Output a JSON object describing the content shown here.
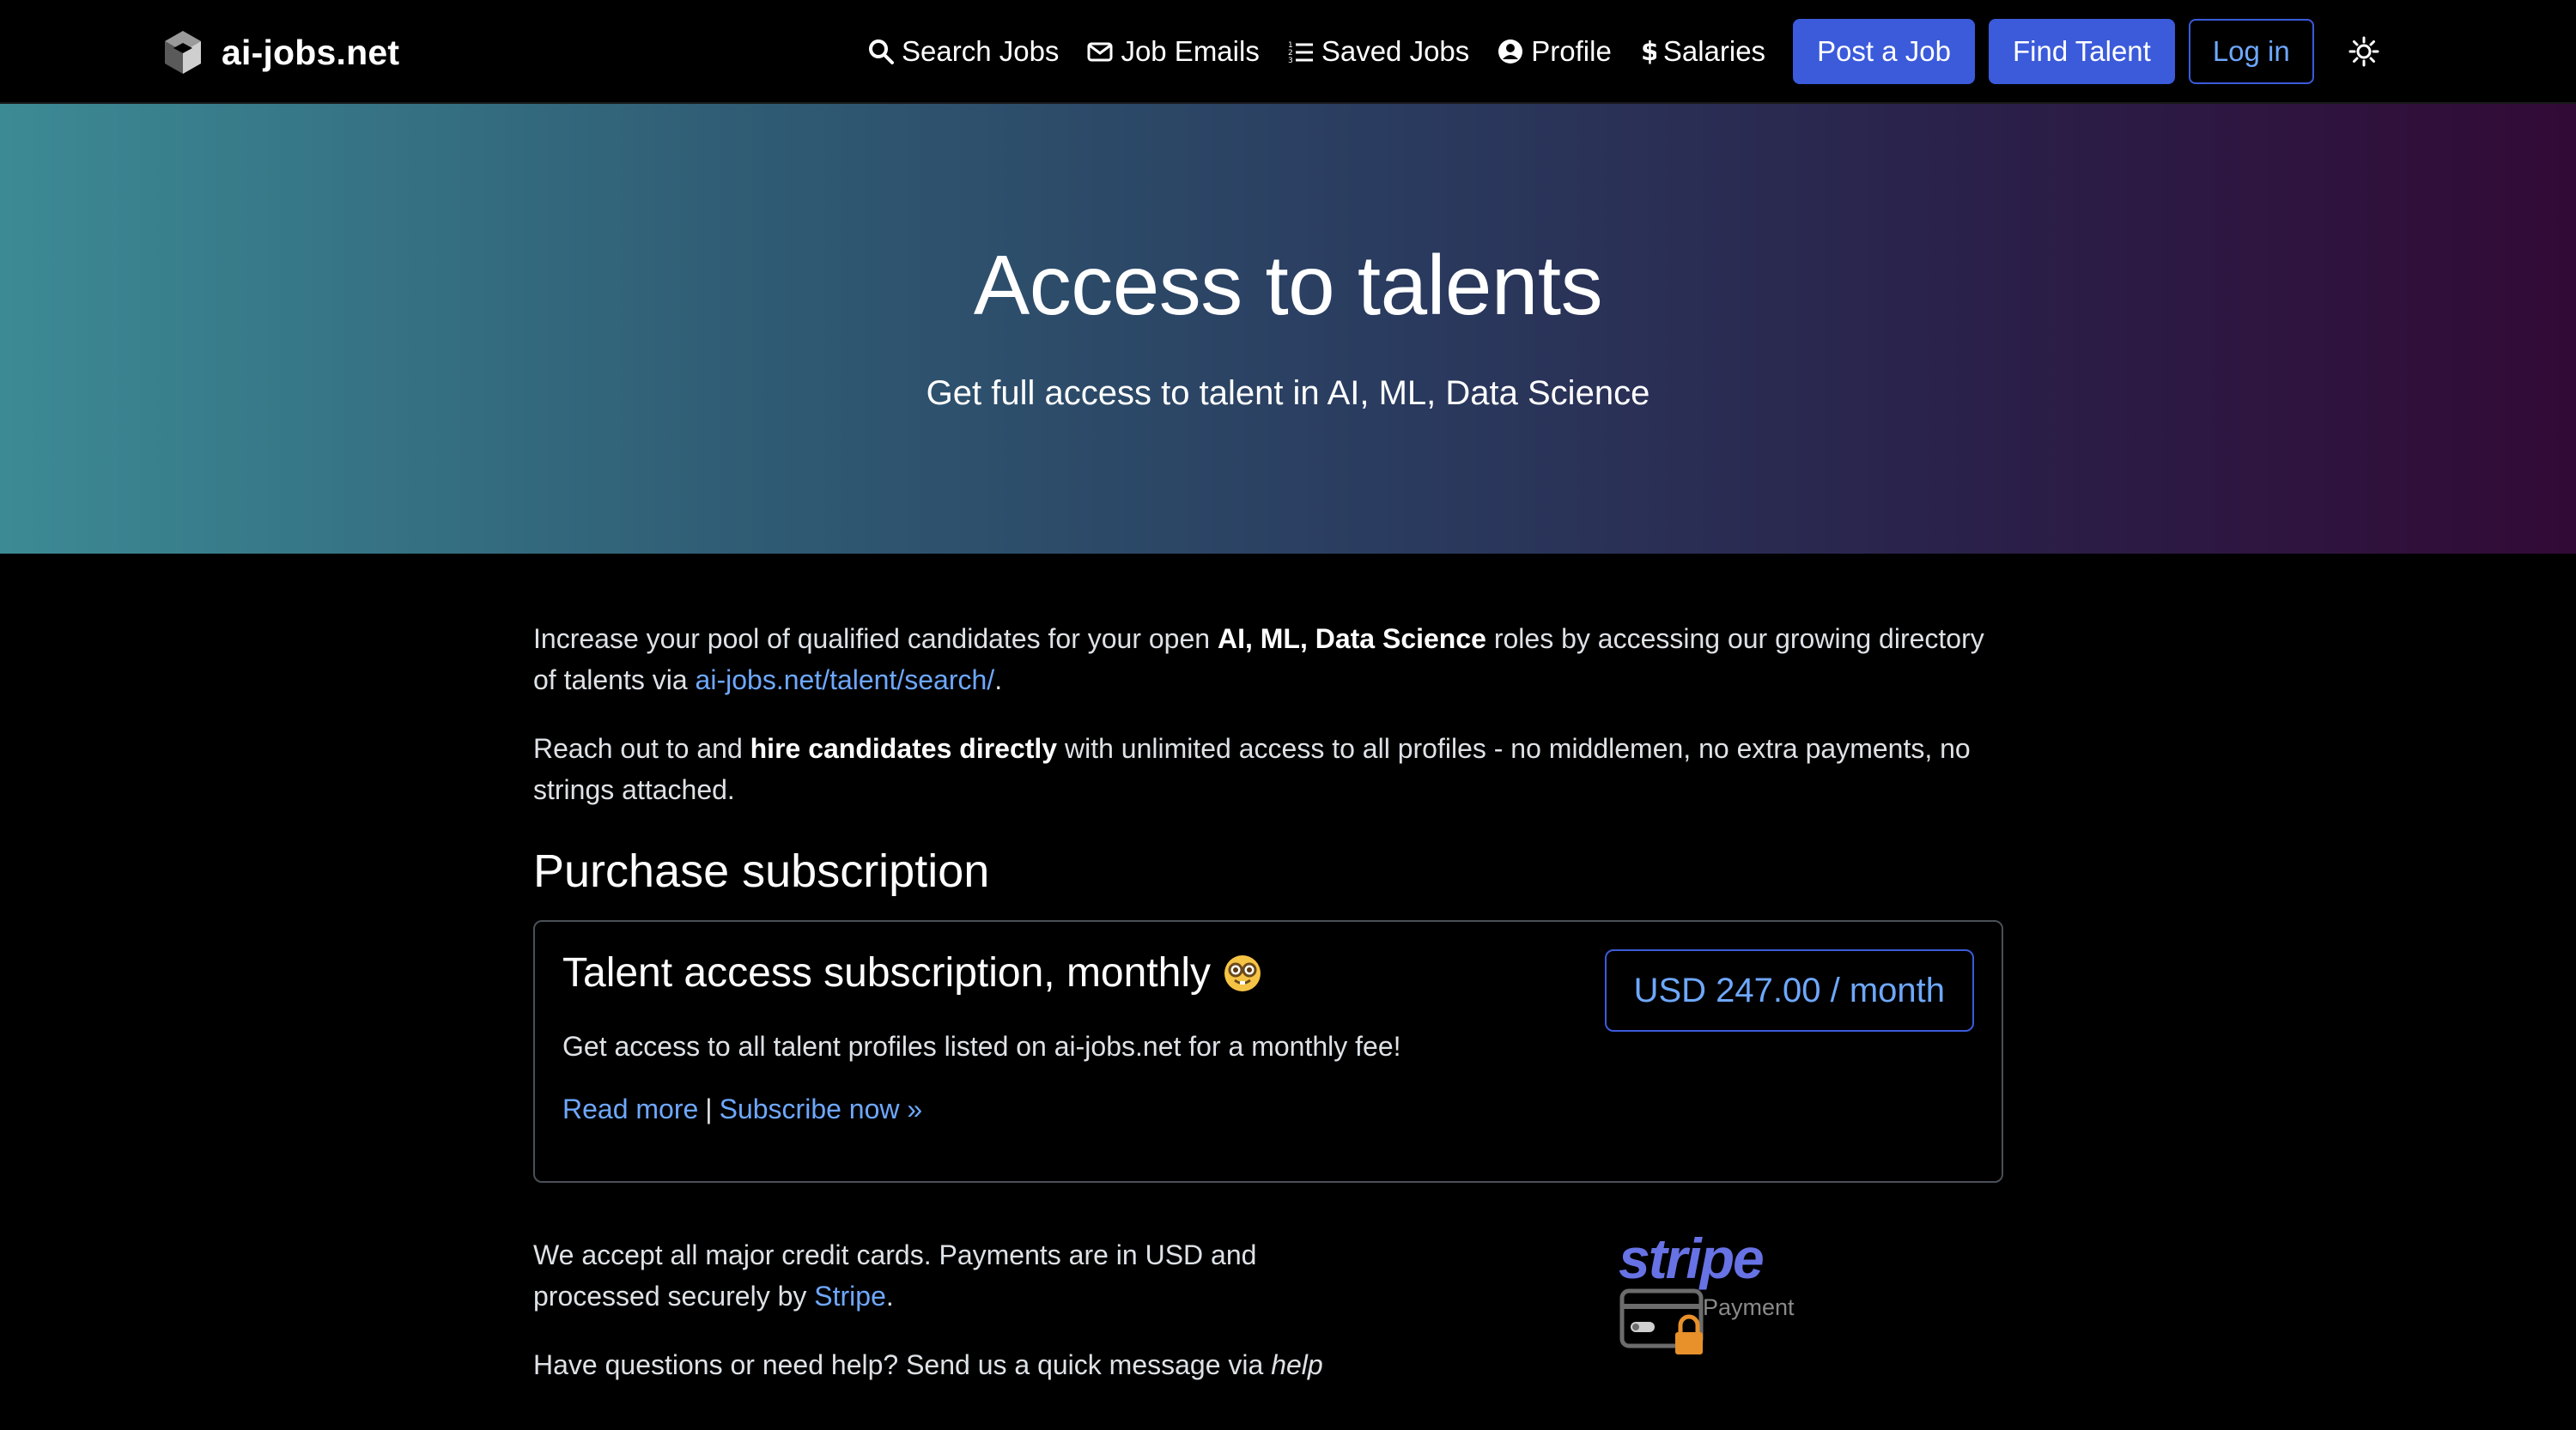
{
  "brand": {
    "name": "ai-jobs.net"
  },
  "nav": {
    "links": [
      {
        "label": "Search Jobs",
        "icon": "search-icon"
      },
      {
        "label": "Job Emails",
        "icon": "envelope-icon"
      },
      {
        "label": "Saved Jobs",
        "icon": "list-icon"
      },
      {
        "label": "Profile",
        "icon": "user-circle-icon"
      },
      {
        "label": "Salaries",
        "icon": "dollar-icon"
      }
    ],
    "post_job": "Post a Job",
    "find_talent": "Find Talent",
    "login": "Log in",
    "theme_icon": "sun-icon"
  },
  "hero": {
    "title": "Access to talents",
    "subtitle": "Get full access to talent in AI, ML, Data Science"
  },
  "intro": {
    "p1_a": "Increase your pool of qualified candidates for your open ",
    "p1_bold": "AI, ML, Data Science",
    "p1_b": " roles by accessing our growing directory of talents via ",
    "p1_link": "ai-jobs.net/talent/search/",
    "p1_end": ".",
    "p2_a": "Reach out to and ",
    "p2_bold": "hire candidates directly",
    "p2_b": " with unlimited access to all profiles - no middlemen, no extra payments, no strings attached."
  },
  "purchase": {
    "heading": "Purchase subscription",
    "card": {
      "title": "Talent access subscription, monthly",
      "emoji": "nerd-face-icon",
      "description": "Get access to all talent profiles listed on ai-jobs.net for a monthly fee!",
      "read_more": "Read more",
      "separator": "|",
      "subscribe": "Subscribe now »",
      "price": "USD 247.00 / month"
    }
  },
  "payment": {
    "p1_a": "We accept all major credit cards. Payments are in USD and processed securely by ",
    "p1_link": "Stripe",
    "p1_end": ".",
    "p2_a": "Have questions or need help? Send us a quick message via ",
    "p2_em": "help",
    "stripe_word": "stripe",
    "stripe_payment": "Payment"
  },
  "colors": {
    "accent": "#3b5bdb",
    "link": "#6ea8fe",
    "stripe": "#6772e5"
  }
}
